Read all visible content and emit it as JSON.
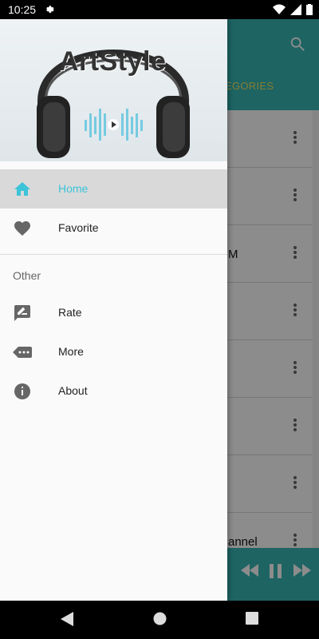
{
  "status_bar": {
    "time": "10:25"
  },
  "app": {
    "tab_partial": "EGORIES",
    "row_partials": [
      "",
      "",
      "M",
      "",
      "",
      "",
      "",
      "annel"
    ]
  },
  "drawer": {
    "header": {
      "brand": "ArtStyle"
    },
    "items": [
      {
        "label": "Home",
        "icon": "home-icon",
        "active": true
      },
      {
        "label": "Favorite",
        "icon": "heart-icon",
        "active": false
      }
    ],
    "section_title": "Other",
    "other_items": [
      {
        "label": "Rate",
        "icon": "rate-icon"
      },
      {
        "label": "More",
        "icon": "more-icon"
      },
      {
        "label": "About",
        "icon": "info-icon"
      }
    ]
  },
  "colors": {
    "accent": "#3cc4d8",
    "teal": "#35b7b5",
    "tab_text": "#f2e35c"
  }
}
